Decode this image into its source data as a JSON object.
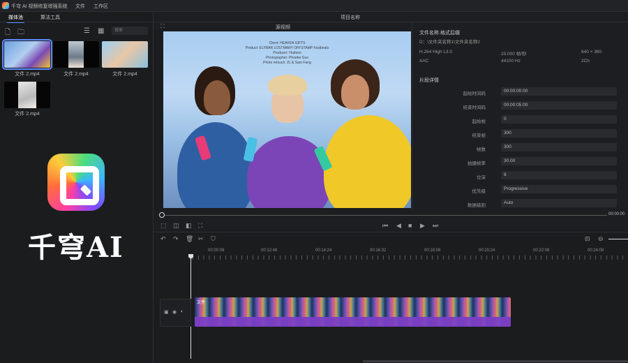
{
  "titlebar": {
    "app_title": "千穹 AI 视频修复增强系统",
    "menu": [
      "文件",
      "工作区"
    ]
  },
  "leftpanel": {
    "tabs": [
      "媒体池",
      "算法工具"
    ],
    "search_placeholder": "搜索",
    "media": [
      {
        "label": "文件 2.mp4",
        "selected": true
      },
      {
        "label": "文件 2.mp4",
        "selected": false
      },
      {
        "label": "文件 2.mp4",
        "selected": false
      },
      {
        "label": "文件 2.mp4",
        "selected": false
      }
    ]
  },
  "brand": {
    "text": "千穹AI"
  },
  "project": {
    "title": "项目名称"
  },
  "preview": {
    "label": "源视频",
    "credits": [
      "Client: HEAVEN GIFTS",
      "Product: ELFBAR LOSTMARY OFFSTAMP Fastbeats",
      "Producer: Hudson",
      "Photographer: Phoebe Guo",
      "Photo retouch: Zc & Sam Fang"
    ]
  },
  "info": {
    "filename_title": "文件名称.格式后缀",
    "path": "D：\\文件夹名称1\\文件夹名称2",
    "video_codec": "H.264 High L3.0",
    "fps": "25.000 帧/秒",
    "resolution": "640 × 360",
    "audio_codec": "AAC",
    "sample_rate": "44100 Hz",
    "channels": "2Ch",
    "section_title": "片段详情",
    "props": [
      {
        "label": "起始时间码",
        "value": "00:00:00:00"
      },
      {
        "label": "结束时间码",
        "value": "00:00:05:00"
      },
      {
        "label": "起始帧",
        "value": "0"
      },
      {
        "label": "结束帧",
        "value": "300"
      },
      {
        "label": "帧数",
        "value": "300"
      },
      {
        "label": "拍摄帧率",
        "value": "30.00"
      },
      {
        "label": "位深",
        "value": "8"
      },
      {
        "label": "优先级",
        "value": "Progressive"
      },
      {
        "label": "数据级别",
        "value": "Auto"
      }
    ]
  },
  "playback": {
    "timecode": "00:00:00"
  },
  "timeline": {
    "ruler": [
      "00:00:08",
      "00:12:48",
      "00:14:24",
      "00:16:32",
      "00:18:08",
      "00:20:24",
      "00:22:08",
      "00:24:08"
    ],
    "clip_label": "文件"
  },
  "colors": {
    "accent": "#4d8dff",
    "clip_wave": "#7a3ec4"
  }
}
